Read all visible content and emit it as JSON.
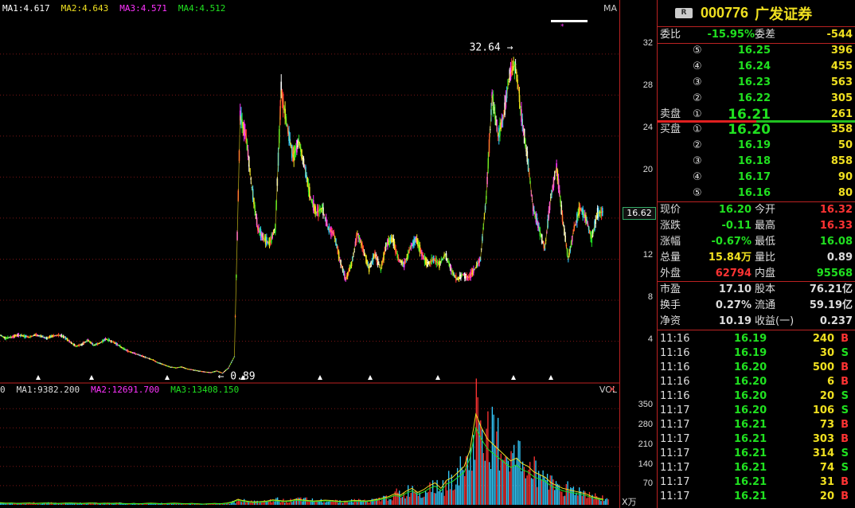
{
  "main_chart": {
    "ma_labels": [
      {
        "text": "MA1:4.617",
        "color": "#ffffff"
      },
      {
        "text": "MA2:4.643",
        "color": "#f0e020"
      },
      {
        "text": "MA3:4.571",
        "color": "#ff33ff"
      },
      {
        "text": "MA4:4.512",
        "color": "#20e020"
      }
    ],
    "indicator": "MA",
    "y_ticks": [
      "32",
      "28",
      "24",
      "20",
      "16",
      "12",
      "8",
      "4"
    ],
    "current_price_tag": "16.62",
    "high_annotation": "32.64",
    "low_annotation": "0.89"
  },
  "volume_chart": {
    "ma_labels": [
      {
        "text": "0",
        "color": "#dddddd"
      },
      {
        "text": "MA1:9382.200",
        "color": "#dddddd"
      },
      {
        "text": "MA2:12691.700",
        "color": "#ff33ff"
      },
      {
        "text": "MA3:13408.150",
        "color": "#20e020"
      }
    ],
    "indicator": "VOL",
    "y_ticks": [
      "350",
      "280",
      "210",
      "140",
      "70"
    ],
    "unit": "X万",
    "close_icon": "close-icon"
  },
  "chart_data": {
    "type": "candlestick",
    "ylim": [
      0,
      35
    ],
    "high": 32.64,
    "low": 0.89,
    "current": 16.62,
    "price_series": [
      4.6,
      4.3,
      4.4,
      4.6,
      4.5,
      4.4,
      4.6,
      4.5,
      4.3,
      4.5,
      4.6,
      4.4,
      3.9,
      3.5,
      3.7,
      4.1,
      3.6,
      3.8,
      4.2,
      4.0,
      3.7,
      3.3,
      3.0,
      2.8,
      2.6,
      2.4,
      2.2,
      1.9,
      1.7,
      1.5,
      1.4,
      1.5,
      1.3,
      1.2,
      1.1,
      1.0,
      0.95,
      1.1,
      0.89,
      1.4,
      2.5,
      26.0,
      24.0,
      19.0,
      15.0,
      14.0,
      13.5,
      15.0,
      28.5,
      25.0,
      22.0,
      23.5,
      21.0,
      18.0,
      16.5,
      17.0,
      15.0,
      14.5,
      12.0,
      10.0,
      11.5,
      14.5,
      13.0,
      11.0,
      12.5,
      11.0,
      13.5,
      14.0,
      12.0,
      11.5,
      13.0,
      14.0,
      12.5,
      11.5,
      12.0,
      11.5,
      12.5,
      11.0,
      10.0,
      10.5,
      10.2,
      11.0,
      12.0,
      18.0,
      28.0,
      24.0,
      26.0,
      30.0,
      31.0,
      26.0,
      22.0,
      17.0,
      15.0,
      13.0,
      18.0,
      21.0,
      16.0,
      12.0,
      15.0,
      17.0,
      16.0,
      14.0,
      16.5,
      16.62
    ],
    "volume_series": [
      8,
      6,
      7,
      5,
      6,
      7,
      5,
      6,
      7,
      6,
      5,
      6,
      7,
      6,
      5,
      6,
      7,
      5,
      6,
      5,
      6,
      5,
      4,
      5,
      4,
      5,
      6,
      5,
      4,
      5,
      6,
      5,
      4,
      5,
      4,
      3,
      4,
      5,
      4,
      6,
      10,
      20,
      15,
      12,
      10,
      12,
      14,
      18,
      16,
      14,
      15,
      20,
      18,
      16,
      14,
      15,
      17,
      16,
      14,
      12,
      14,
      16,
      15,
      14,
      16,
      20,
      25,
      30,
      40,
      35,
      50,
      60,
      45,
      55,
      70,
      80,
      60,
      90,
      100,
      120,
      140,
      200,
      330,
      280,
      240,
      220,
      200,
      180,
      160,
      170,
      150,
      140,
      120,
      110,
      100,
      80,
      70,
      60,
      55,
      50,
      45,
      40,
      30,
      25,
      20
    ],
    "volume_ylim": [
      0,
      400
    ]
  },
  "order_book": {
    "stock_badge": "R",
    "stock_code": "000776",
    "stock_name": "广发证券",
    "weibi_label": "委比",
    "weibi_value": "-15.95%",
    "weicha_label": "委差",
    "weicha_value": "-544",
    "sell_label": "卖盘",
    "buy_label": "买盘",
    "asks": [
      {
        "level": "⑤",
        "price": "16.25",
        "qty": "396"
      },
      {
        "level": "④",
        "price": "16.24",
        "qty": "455"
      },
      {
        "level": "③",
        "price": "16.23",
        "qty": "563"
      },
      {
        "level": "②",
        "price": "16.22",
        "qty": "305"
      },
      {
        "level": "①",
        "price": "16.21",
        "qty": "261"
      }
    ],
    "bids": [
      {
        "level": "①",
        "price": "16.20",
        "qty": "358"
      },
      {
        "level": "②",
        "price": "16.19",
        "qty": "50"
      },
      {
        "level": "③",
        "price": "16.18",
        "qty": "858"
      },
      {
        "level": "④",
        "price": "16.17",
        "qty": "90"
      },
      {
        "level": "⑤",
        "price": "16.16",
        "qty": "80"
      }
    ]
  },
  "quote_stats": {
    "rows": [
      {
        "l1": "现价",
        "v1": "16.20",
        "c1": "green",
        "l2": "今开",
        "v2": "16.32",
        "c2": "red"
      },
      {
        "l1": "涨跌",
        "v1": "-0.11",
        "c1": "green",
        "l2": "最高",
        "v2": "16.33",
        "c2": "red"
      },
      {
        "l1": "涨幅",
        "v1": "-0.67%",
        "c1": "green",
        "l2": "最低",
        "v2": "16.08",
        "c2": "green"
      },
      {
        "l1": "总量",
        "v1": "15.84万",
        "c1": "yellow",
        "l2": "量比",
        "v2": "0.89",
        "c2": "white"
      },
      {
        "l1": "外盘",
        "v1": "62794",
        "c1": "red",
        "l2": "内盘",
        "v2": "95568",
        "c2": "green"
      }
    ],
    "fundamentals": [
      {
        "l1": "市盈",
        "v1": "17.10",
        "l2": "股本",
        "v2": "76.21亿"
      },
      {
        "l1": "换手",
        "v1": "0.27%",
        "l2": "流通",
        "v2": "59.19亿"
      },
      {
        "l1": "净资",
        "v1": "10.19",
        "l2": "收益(一)",
        "v2": "0.237"
      }
    ]
  },
  "ticks": [
    {
      "time": "11:16",
      "price": "16.19",
      "vol": "240",
      "side": "B"
    },
    {
      "time": "11:16",
      "price": "16.19",
      "vol": "30",
      "side": "S"
    },
    {
      "time": "11:16",
      "price": "16.20",
      "vol": "500",
      "side": "B"
    },
    {
      "time": "11:16",
      "price": "16.20",
      "vol": "6",
      "side": "B"
    },
    {
      "time": "11:16",
      "price": "16.20",
      "vol": "20",
      "side": "S"
    },
    {
      "time": "11:17",
      "price": "16.20",
      "vol": "106",
      "side": "S"
    },
    {
      "time": "11:17",
      "price": "16.21",
      "vol": "73",
      "side": "B"
    },
    {
      "time": "11:17",
      "price": "16.21",
      "vol": "303",
      "side": "B"
    },
    {
      "time": "11:17",
      "price": "16.21",
      "vol": "314",
      "side": "S"
    },
    {
      "time": "11:17",
      "price": "16.21",
      "vol": "74",
      "side": "S"
    },
    {
      "time": "11:17",
      "price": "16.21",
      "vol": "31",
      "side": "B"
    },
    {
      "time": "11:17",
      "price": "16.21",
      "vol": "20",
      "side": "B"
    }
  ]
}
